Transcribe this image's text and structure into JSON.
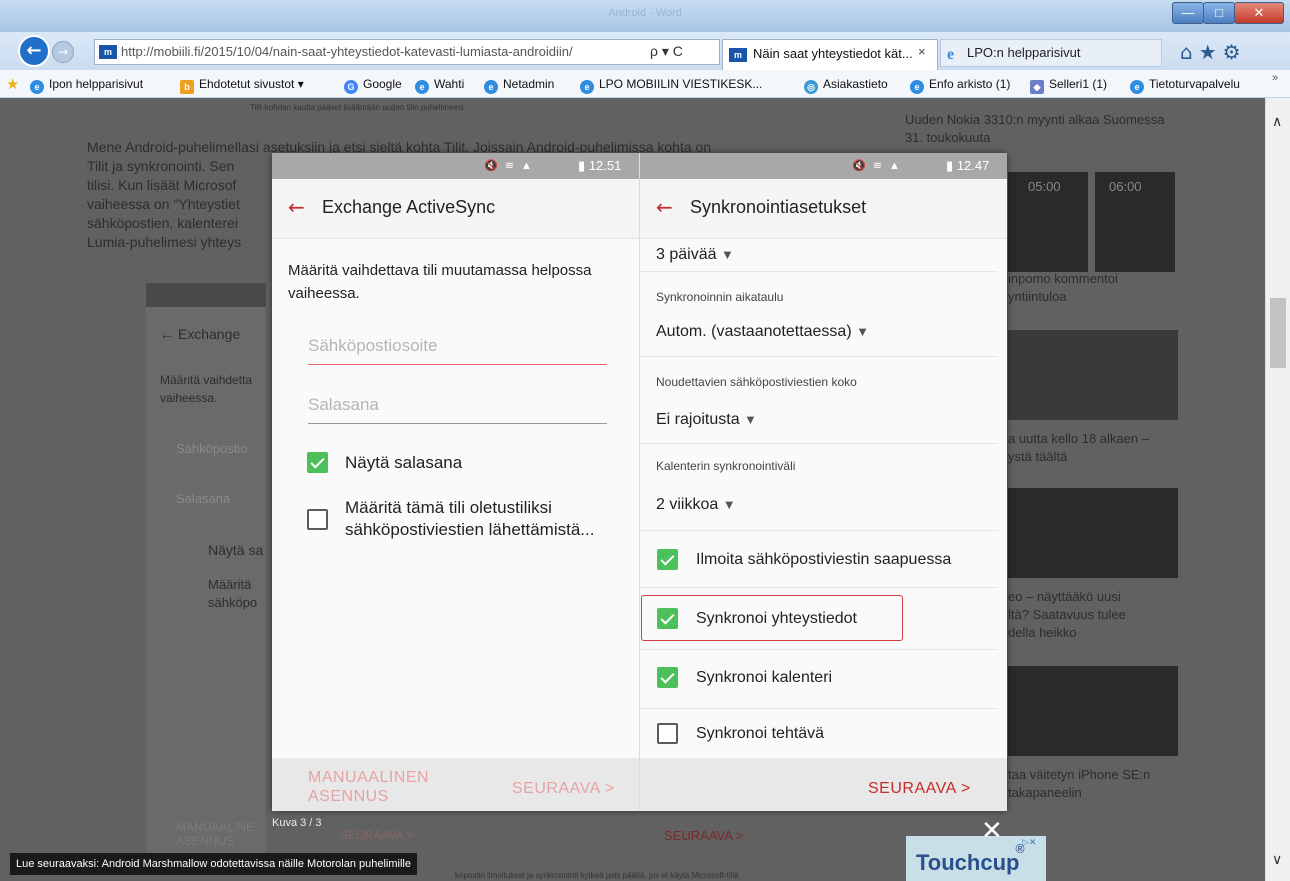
{
  "window": {
    "title": "Android - Word",
    "minimize_label": "—",
    "maximize_label": "□",
    "close_label": "✕"
  },
  "nav": {
    "back_label": "←",
    "forward_label": "→",
    "address": "http://mobiili.fi/2015/10/04/nain-saat-yhteystiedot-katevasti-lumiasta-androidiin/",
    "address_favicon": "m",
    "address_actions": "ρ ▾ C",
    "tabs": [
      {
        "label": "Näin saat yhteystiedot kät...",
        "close": "×"
      },
      {
        "label": "LPO:n helpparisivut"
      }
    ],
    "tool_icons": "⌂★⚙"
  },
  "favorites": {
    "items": [
      {
        "label": "Ipon helpparisivut",
        "icon": "e"
      },
      {
        "label": "Ehdotetut sivustot ▾",
        "icon": "b"
      },
      {
        "label": "Google",
        "icon": "G"
      },
      {
        "label": "Wahti",
        "icon": "e"
      },
      {
        "label": "Netadmin",
        "icon": "e"
      },
      {
        "label": "LPO MOBIILIN VIESTIKESK...",
        "icon": "e"
      },
      {
        "label": "Asiakastieto",
        "icon": "◎"
      },
      {
        "label": "Enfo arkisto (1)",
        "icon": "e"
      },
      {
        "label": "Selleri1 (1)",
        "icon": "◆"
      },
      {
        "label": "Tietoturvapalvelu",
        "icon": "e"
      }
    ],
    "more": "»"
  },
  "background_page": {
    "caption": "Tilit-kohdan kautta pääset lisäämään uuden tilin puhelimeesi",
    "paragraph_lines": [
      "Mene Android-puhelimellasi asetuksiin ja etsi sieltä kohta Tilit. Joissain Android-puhelimissa kohta on",
      "Tilit ja synkronointi. Sen",
      "tilisi. Kun lisäät Microsof",
      "vaiheessa on \"Yhteystiet",
      "sähköpostien, kalenterei",
      "Lumia-puhelimesi yhteys"
    ],
    "side_items": [
      "Uuden Nokia 3310:n myynti alkaa Suomessa",
      "31. toukokuuta",
      "inpomo kommentoi",
      "yntiintuloa",
      "a uutta kello 18 alkaen –",
      "ystä täältä",
      "eo – näyttääkö uusi",
      "ltä? Saatavuus tulee",
      "della heikko",
      "taa väitetyn iPhone SE:n",
      "takapaneelin"
    ],
    "thumb_times": [
      "05:00",
      "06:00"
    ],
    "left_card": {
      "back": "←  Exchange",
      "line1": "Määritä vaihdetta",
      "line2": "vaiheessa.",
      "email": "Sähköpostio",
      "password": "Salasana",
      "show": "Näytä sa",
      "default1": "Määritä",
      "default2": "sähköpo"
    },
    "bottom_left": "MANUAALINE ASENNUS",
    "bottom_seuraava_1": "SEURAAVA  >",
    "bottom_seuraava_2": "SEURAAVA  >",
    "bottom_caption": "köpostin ilmoitukset ja synkronointi kytkeä pois päältä, jos et käytä Microsoft-tiliä"
  },
  "left_phone": {
    "status_icons": "🔇 ≋ ▲",
    "status_time": "▮ 12.51",
    "back_icon": "←",
    "title": "Exchange ActiveSync",
    "instruction_line1": "Määritä vaihdettava tili muutamassa helpossa",
    "instruction_line2": "vaiheessa.",
    "email_placeholder": "Sähköpostiosoite",
    "password_placeholder": "Salasana",
    "show_password": "Näytä salasana",
    "default_account_line1": "Määritä tämä tili oletustiliksi",
    "default_account_line2": "sähköpostiviestien lähettämistä...",
    "footer_manual_line1": "MANUAALINEN",
    "footer_manual_line2": "ASENNUS",
    "footer_next": "SEURAAVA  >"
  },
  "right_phone": {
    "status_icons": "🔇 ≋ ▲",
    "status_time": "▮ 12.47",
    "back_icon": "←",
    "title": "Synkronointiasetukset",
    "period_value": "3 päivää",
    "schedule_label": "Synkronoinnin aikataulu",
    "schedule_value": "Autom. (vastaanotettaessa)",
    "size_label": "Noudettavien sähköpostiviestien koko",
    "size_value": "Ei rajoitusta",
    "calendar_label": "Kalenterin synkronointiväli",
    "calendar_value": "2 viikkoa",
    "dropdown_arrow": "▼",
    "notify_label": "Ilmoita sähköpostiviestin saapuessa",
    "sync_contacts": "Synkronoi yhteystiedot",
    "sync_calendar": "Synkronoi kalenteri",
    "sync_tasks": "Synkronoi tehtävä",
    "footer_next": "SEURAAVA  >"
  },
  "lightbox": {
    "counter": "Kuva 3 / 3",
    "close": "✕"
  },
  "ad": {
    "text": "Touchcup",
    "mark": "®",
    "badge": "▷✕"
  },
  "status_tip": "Lue seuraavaksi: Android Marshmallow odotettavissa näille Motorolan puhelimille",
  "scrollbar": {
    "up": "∧",
    "down": "∨"
  }
}
